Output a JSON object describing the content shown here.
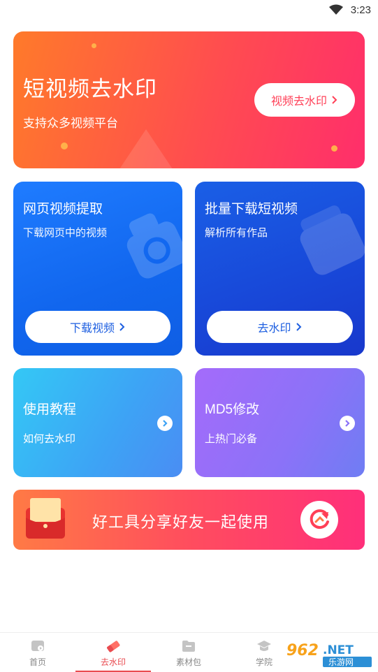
{
  "status_bar": {
    "time": "3:23"
  },
  "banner": {
    "title": "短视频去水印",
    "subtitle": "支持众多视频平台",
    "button": "视频去水印"
  },
  "cards": {
    "web_extract": {
      "title": "网页视频提取",
      "subtitle": "下载网页中的视频",
      "button": "下载视频"
    },
    "batch_download": {
      "title": "批量下载短视频",
      "subtitle": "解析所有作品",
      "button": "去水印"
    },
    "tutorial": {
      "title": "使用教程",
      "subtitle": "如何去水印"
    },
    "md5": {
      "title": "MD5修改",
      "subtitle": "上热门必备"
    }
  },
  "share_banner": {
    "text": "好工具分享好友一起使用"
  },
  "tabbar": {
    "items": [
      {
        "label": "首页",
        "icon": "home-video-icon"
      },
      {
        "label": "去水印",
        "icon": "eraser-icon",
        "active": true
      },
      {
        "label": "素材包",
        "icon": "folder-icon"
      },
      {
        "label": "学院",
        "icon": "graduation-cap-icon"
      }
    ]
  },
  "watermark": {
    "brand": "962.NET",
    "sub": "乐游网"
  },
  "colors": {
    "accent": "#e94b50",
    "banner_start": "#ff7a2a",
    "banner_end": "#ff2e6b"
  }
}
